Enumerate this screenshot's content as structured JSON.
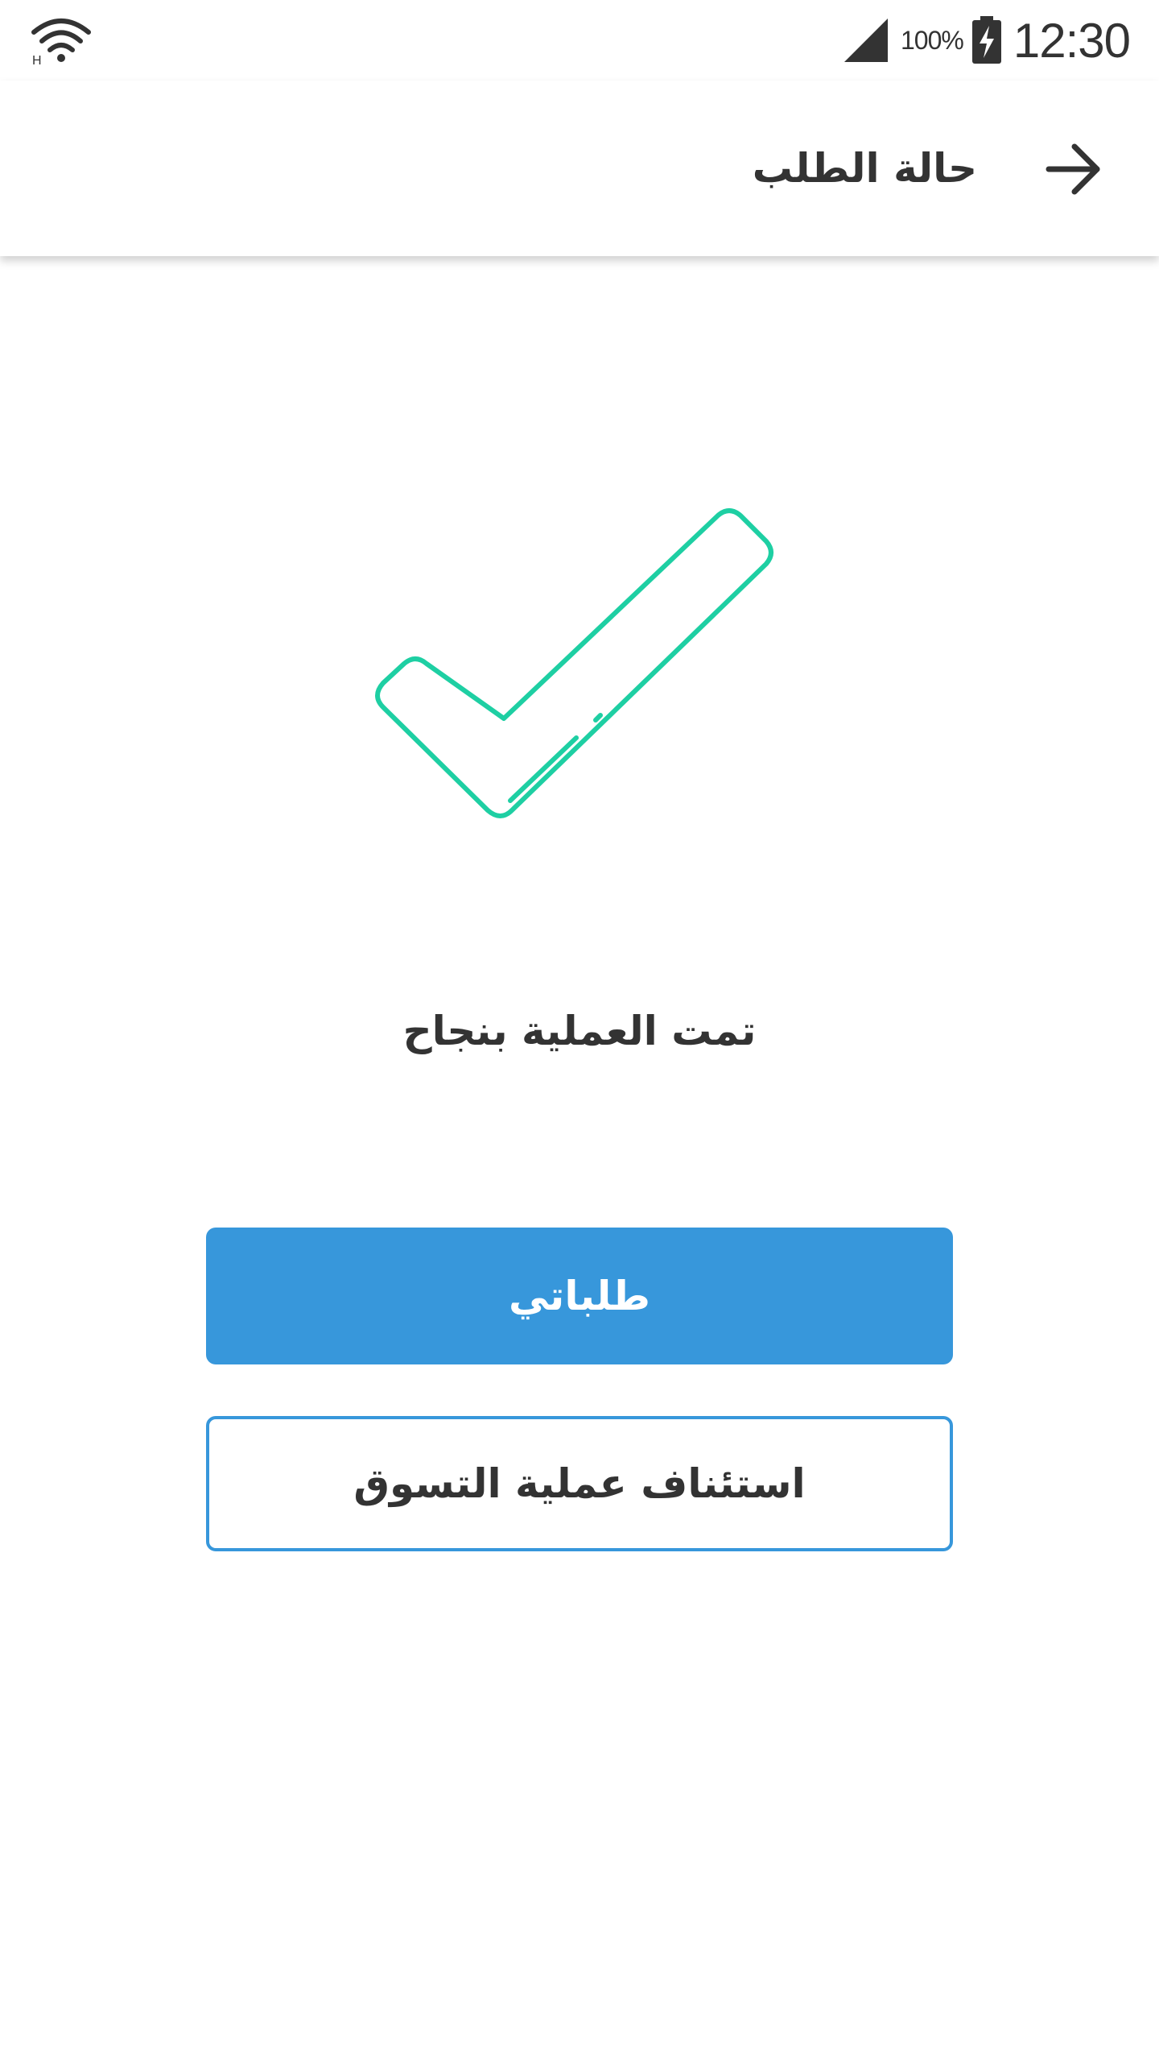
{
  "status_bar": {
    "battery_percent": "100%",
    "time": "12:30",
    "wifi_icon": "wifi-icon",
    "signal_icon": "cell-signal-icon",
    "battery_icon": "battery-charging-icon"
  },
  "app_bar": {
    "title": "حالة الطلب",
    "back_icon": "arrow-right-icon"
  },
  "main": {
    "illustration_icon": "checkmark-icon",
    "success_message": "تمت العملية بنجاح",
    "my_orders_label": "طلباتي",
    "continue_shopping_label": "استئناف عملية التسوق"
  },
  "colors": {
    "primary_button": "#3797db",
    "check_accent": "#1ecfa3",
    "text": "#333333"
  }
}
